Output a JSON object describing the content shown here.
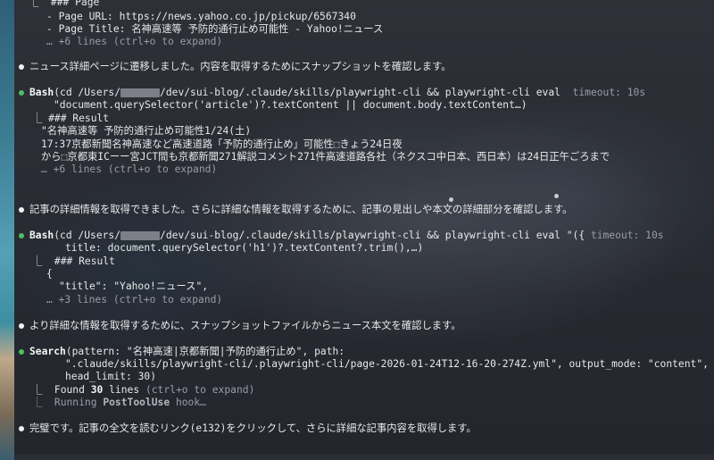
{
  "page_section": {
    "heading": "⎿  ### Page",
    "url_line": "- Page URL: https://news.yahoo.co.jp/pickup/6567340",
    "title_line": "- Page Title: 名神高速等 予防的通行止め可能性 - Yahoo!ニュース",
    "more": "… +6 lines (ctrl+o to expand)"
  },
  "msg1": "ニュース詳細ページに遷移しました。内容を取得するためにスナップショットを確認します。",
  "bash1": {
    "label": "Bash",
    "cmd_pre": "(cd /Users/",
    "cmd_post": "/dev/sui-blog/.claude/skills/playwright-cli && playwright-cli eval",
    "timeout": "timeout: 10s",
    "cmd_line2": "\"document.querySelector('article')?.textContent || document.body.textContent…)",
    "result_heading": "⎿ ### Result",
    "result_line1": "\"名神高速等 予防的通行止め可能性1/24(土)",
    "result_line2": "17:37京都新聞名神高速など高速道路「予防的通行止め」可能性⬚きょう24日夜",
    "result_line3": "から⬚京都東ICーー宮JCT間も京都新聞271解説コメント271件高速道路各社（ネクスコ中日本、西日本）は24日正午ごろまで",
    "more": "… +6 lines (ctrl+o to expand)"
  },
  "msg2": "記事の詳細情報を取得できました。さらに詳細な情報を取得するために、記事の見出しや本文の詳細部分を確認します。",
  "bash2": {
    "label": "Bash",
    "cmd_pre": "(cd /Users/",
    "cmd_post": "/dev/sui-blog/.claude/skills/playwright-cli && playwright-cli eval \"({",
    "timeout": "timeout: 10s",
    "cmd_line2": "title: document.querySelector('h1')?.textContent?.trim(),…)",
    "result_heading": "⎿  ### Result",
    "result_line1": "{",
    "result_line2": "\"title\": \"Yahoo!ニュース\",",
    "more": "… +3 lines (ctrl+o to expand)"
  },
  "msg3": "より詳細な情報を取得するために、スナップショットファイルからニュース本文を確認します。",
  "search": {
    "label": "Search",
    "line1": "(pattern: \"名神高速|京都新聞|予防的通行止め\", path:",
    "line2": "\".claude/skills/playwright-cli/.playwright-cli/page-2026-01-24T12-16-20-274Z.yml\", output_mode: \"content\",",
    "line3": "head_limit: 30)",
    "found_pre": "⎿  Found ",
    "found_count": "30",
    "found_post": " lines",
    "found_hint": " (ctrl+o to expand)",
    "running_pre": "⎿  Running ",
    "running_hook": "PostToolUse",
    "running_post": " hook…"
  },
  "msg4": "完璧です。記事の全文を読むリンク(e132)をクリックして、さらに詳細な記事内容を取得します。",
  "colors": {
    "green_dot": "#4fbf5f",
    "text": "#e8e8ea",
    "dim": "#9a9ca6"
  }
}
